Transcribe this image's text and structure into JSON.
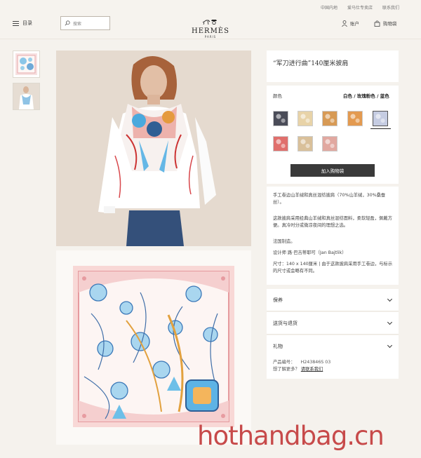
{
  "header": {
    "util_links": [
      "中国内地",
      "爱马仕专卖店",
      "联系我们"
    ],
    "menu_label": "目录",
    "search_placeholder": "搜索",
    "logo_word": "HERMÈS",
    "logo_sub": "PARIS",
    "account_label": "账户",
    "cart_label": "购物袋"
  },
  "product": {
    "title": "“军刀进行曲”140厘米披肩",
    "color_label": "颜色",
    "color_value": "白色 / 玫瑰粉色 / 蓝色",
    "swatch_colors": [
      "#4a4c58",
      "#e8d3a8",
      "#d79a55",
      "#e39a50",
      "#c5cce2",
      "#e06f6c",
      "#d9c09a",
      "#e1a8a0"
    ],
    "selected_swatch": 4,
    "add_to_cart": "加入购物袋",
    "desc_1": "手工卷边山羊绒和真丝混纺披肩（70%山羊绒，30%桑蚕丝）。",
    "desc_2": "这款披肩采用经典山羊绒和真丝混纺面料，柔软轻盈，佩戴方便。真冷时分或微凉夜间的理想之选。",
    "desc_3": "法国制造。",
    "desc_4": "设计师 路·巴吉蒂耶可（Jan Bajtlik）",
    "desc_5": "尺寸：140 x 140厘米 | 由于这款披肩采用手工卷边，与标示的尺寸或会略有不同。",
    "acc_care": "保养",
    "acc_delivery": "送货与退货",
    "acc_gift": "礼物",
    "ref_label": "产品编号：",
    "ref_value": "H243846S 03",
    "help_text": "想了解更多？",
    "help_link": "请联系我们"
  },
  "watermark": "hothandbag.cn"
}
